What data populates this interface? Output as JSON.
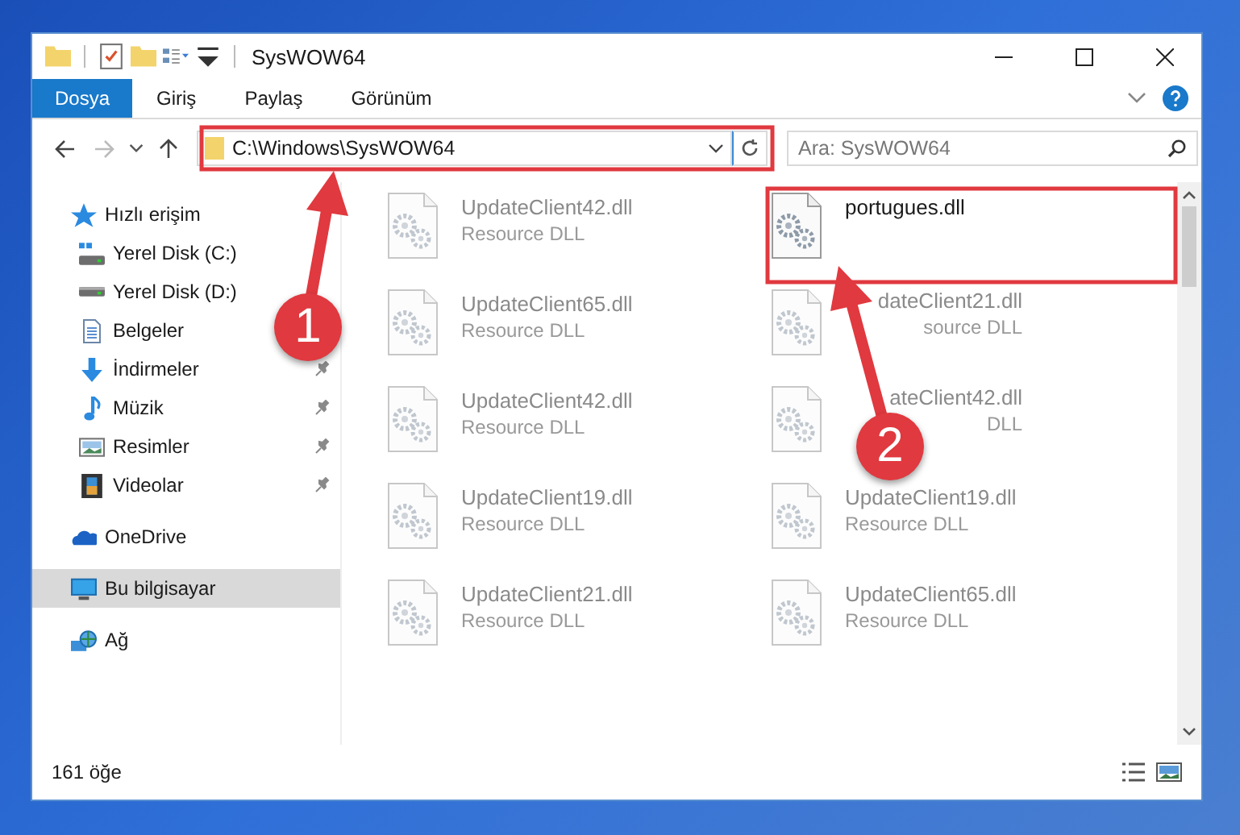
{
  "window": {
    "title": "SysWOW64"
  },
  "tabs": [
    {
      "label": "Dosya",
      "selected": true
    },
    {
      "label": "Giriş",
      "selected": false
    },
    {
      "label": "Paylaş",
      "selected": false
    },
    {
      "label": "Görünüm",
      "selected": false
    }
  ],
  "address": {
    "path": "C:\\Windows\\SysWOW64"
  },
  "search": {
    "placeholder": "Ara: SysWOW64"
  },
  "navigation": [
    {
      "label": "Hızlı erişim",
      "kind": "star",
      "selected": false,
      "children": [
        {
          "label": "Yerel Disk (C:)",
          "kind": "drive-c",
          "pinned": false
        },
        {
          "label": "Yerel Disk (D:)",
          "kind": "drive",
          "pinned": false
        },
        {
          "label": "Belgeler",
          "kind": "documents",
          "pinned": false
        },
        {
          "label": "İndirmeler",
          "kind": "download",
          "pinned": true
        },
        {
          "label": "Müzik",
          "kind": "music",
          "pinned": true
        },
        {
          "label": "Resimler",
          "kind": "pictures",
          "pinned": true
        },
        {
          "label": "Videolar",
          "kind": "videos",
          "pinned": true
        }
      ]
    },
    {
      "label": "OneDrive",
      "kind": "cloud",
      "selected": false
    },
    {
      "label": "Bu bilgisayar",
      "kind": "computer",
      "selected": true
    },
    {
      "label": "Ağ",
      "kind": "network",
      "selected": false
    }
  ],
  "files": [
    {
      "name": "UpdateClient42.dll",
      "type": "Resource DLL",
      "kind": "full",
      "blurred": true
    },
    {
      "name": "portugues.dll",
      "kind": "full",
      "blurred": false
    },
    {
      "name": "UpdateClient65.dll",
      "type": "Resource DLL",
      "kind": "full",
      "blurred": true
    },
    {
      "name": "dateClient21.dll",
      "type": "source DLL",
      "kind": "cut",
      "blurred": true
    },
    {
      "name": "UpdateClient42.dll",
      "type": "Resource DLL",
      "kind": "full",
      "blurred": true
    },
    {
      "name": "ateClient42.dll",
      "type": "DLL",
      "kind": "cut",
      "blurred": true
    },
    {
      "name": "UpdateClient19.dll",
      "type": "Resource DLL",
      "kind": "full",
      "blurred": true
    },
    {
      "name": "UpdateClient19.dll",
      "type": "Resource DLL",
      "kind": "full",
      "blurred": true
    },
    {
      "name": "UpdateClient21.dll",
      "type": "Resource DLL",
      "kind": "full",
      "blurred": true
    },
    {
      "name": "UpdateClient65.dll",
      "type": "Resource DLL",
      "kind": "full",
      "blurred": true
    }
  ],
  "status_bar": {
    "count": "161 öğe"
  },
  "callouts": [
    {
      "number": "1"
    },
    {
      "number": "2"
    }
  ]
}
